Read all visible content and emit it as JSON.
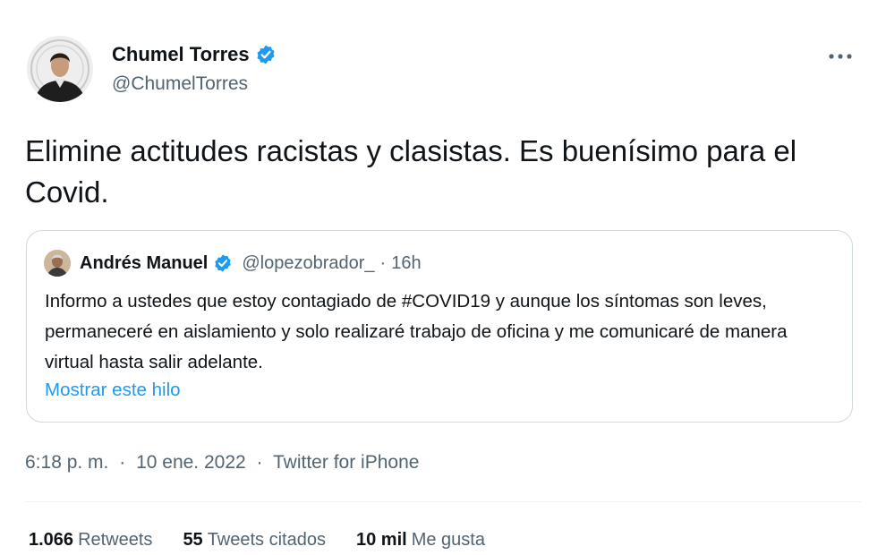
{
  "tweet": {
    "author": {
      "display_name": "Chumel Torres",
      "handle": "@ChumelTorres",
      "verified": true,
      "avatar_icon": "profile-photo-icon"
    },
    "more_icon": "more-options-icon",
    "text": "Elimine actitudes racistas y clasistas. Es buenísimo para el Covid.",
    "quoted": {
      "display_name": "Andrés Manuel",
      "verified": true,
      "handle": "@lopezobrador_",
      "separator": "·",
      "time": "16h",
      "text": "Informo a ustedes que estoy contagiado de #COVID19 y aunque los síntomas son leves, permaneceré en aislamiento y solo realizaré trabajo de oficina y me comunicaré de manera virtual hasta salir adelante.",
      "show_thread_label": "Mostrar este hilo"
    },
    "meta": {
      "time": "6:18 p. m.",
      "separator": "·",
      "date": "10 ene. 2022",
      "source": "Twitter for iPhone"
    },
    "stats": {
      "retweets_count": "1.066",
      "retweets_label": "Retweets",
      "quotes_count": "55",
      "quotes_label": "Tweets citados",
      "likes_count": "10 mil",
      "likes_label": "Me gusta"
    }
  },
  "colors": {
    "verified_blue": "#1d9bf0",
    "link_blue": "#1d9bf0",
    "secondary_text": "#536471",
    "primary_text": "#0f1419",
    "border": "#cfd9de"
  }
}
